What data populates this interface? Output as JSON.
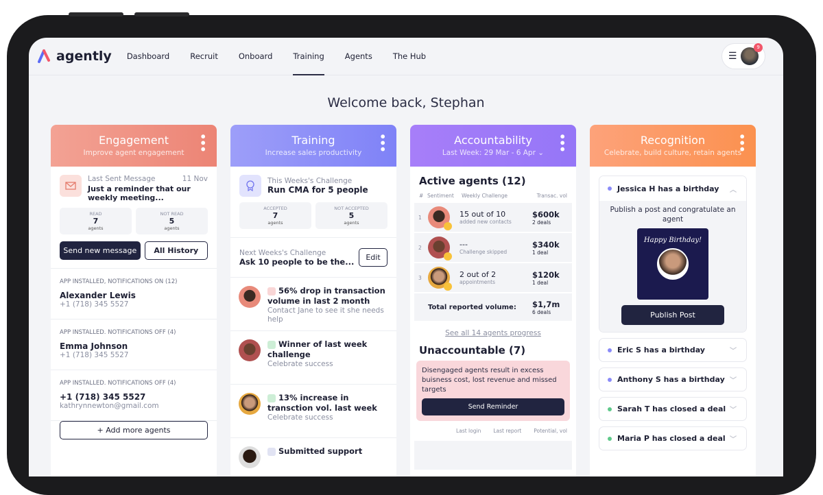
{
  "nav": {
    "brand": "agently",
    "items": [
      "Dashboard",
      "Recruit",
      "Onboard",
      "Training",
      "Agents",
      "The Hub"
    ],
    "active": "Training",
    "notification_count": "9"
  },
  "welcome": "Welcome back, Stephan",
  "colors": {
    "engagement": "#ef8a7c",
    "training": "#8a8bf8",
    "accountability": "#9c7af8",
    "recognition": "#fc9a62",
    "dark_button": "#212440"
  },
  "engagement": {
    "title": "Engagement",
    "subtitle": "Improve agent engagement",
    "last_label": "Last Sent Message",
    "last_date": "11 Nov",
    "last_text": "Just a reminder that our weekly meeting...",
    "stats": [
      {
        "label": "READ",
        "value": "7",
        "unit": "agents"
      },
      {
        "label": "NOT READ",
        "value": "5",
        "unit": "agents"
      }
    ],
    "send_btn": "Send new message",
    "history_btn": "All History",
    "agents": [
      {
        "group": "APP INSTALLED, NOTIFICATIONS ON (12)",
        "name": "Alexander Lewis",
        "sub": "+1 (718) 345 5527"
      },
      {
        "group": "APP INSTALLED. NOTIFICATIONS OFF (4)",
        "name": "Emma Johnson",
        "sub": "+1 (718) 345 5527"
      },
      {
        "group": "APP INSTALLED. NOTIFICATIONS OFF (4)",
        "name": "+1 (718) 345 5527",
        "sub": "kathrynnewton@gmail.com"
      }
    ],
    "add_btn": "+ Add more agents"
  },
  "training": {
    "title": "Training",
    "subtitle": "Increase sales productivity",
    "this_label": "This Weeks's Challenge",
    "this_text": "Run CMA for 5 people",
    "stats": [
      {
        "label": "ACCEPTED",
        "value": "7",
        "unit": "agents"
      },
      {
        "label": "NOT ACCEPTED",
        "value": "5",
        "unit": "agents"
      }
    ],
    "next_label": "Next Weeks's Challenge",
    "next_text": "Ask 10 people to be the...",
    "edit_btn": "Edit",
    "feed": [
      {
        "title": "56% drop in transaction volume in last 2 month",
        "sub": "Contact Jane to see it she needs help",
        "icon": "trend-down-icon",
        "color": "#f9d6d6"
      },
      {
        "title": "Winner of last week challenge",
        "sub": "Celebrate success",
        "icon": "trophy-icon",
        "color": "#cdeed6"
      },
      {
        "title": "13% increase in transction vol. last week",
        "sub": "Celebrate success",
        "icon": "trend-up-icon",
        "color": "#cdeed6"
      },
      {
        "title": "Submitted support",
        "sub": "",
        "icon": "support-icon",
        "color": "#e1e3f3"
      }
    ]
  },
  "accountability": {
    "title": "Accountability",
    "subtitle": "Last Week: 29 Mar - 6 Apr",
    "active_title": "Active agents (12)",
    "headers": [
      "#",
      "Sentiment",
      "Weekly Challenge",
      "Transac. vol"
    ],
    "rows": [
      {
        "n": "1",
        "challenge": "15 out of 10",
        "sub": "added new contacts",
        "vol": "$600k",
        "deals": "2 deals"
      },
      {
        "n": "2",
        "challenge": "---",
        "sub": "Challenge skipped",
        "vol": "$340k",
        "deals": "1 deal"
      },
      {
        "n": "3",
        "challenge": "2 out of 2",
        "sub": "appointments",
        "vol": "$120k",
        "deals": "1 deal"
      }
    ],
    "total_label": "Total reported volume:",
    "total_vol": "$1,7m",
    "total_deals": "6 deals",
    "see_all": "See all 14 agents progress",
    "unacc_title": "Unaccountable (7)",
    "warning": "Disengaged agents result in excess buisness cost, lost revenue and missed targets",
    "reminder_btn": "Send Reminder",
    "headers2": [
      "Last login",
      "Last report",
      "Potential, vol"
    ]
  },
  "recognition": {
    "title": "Recognition",
    "subtitle": "Celebrate, build culture, retain agents",
    "expanded": {
      "title": "Jessica H has a birthday",
      "text": "Publish a post and congratulate an agent",
      "card_text": "Happy Birthday!",
      "publish_btn": "Publish Post"
    },
    "items": [
      {
        "title": "Eric S has a birthday",
        "color": "#8a8bf8"
      },
      {
        "title": "Anthony S has a birthday",
        "color": "#8a8bf8"
      },
      {
        "title": "Sarah T has closed a deal",
        "color": "#5fc98a"
      },
      {
        "title": "Maria P has closed a deal",
        "color": "#5fc98a"
      }
    ]
  }
}
